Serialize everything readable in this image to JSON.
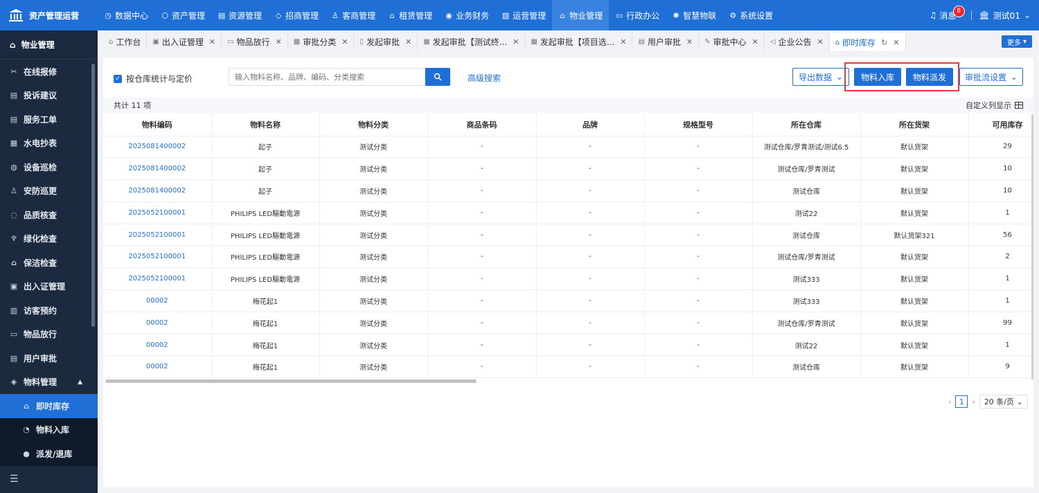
{
  "app": {
    "title": "资产管理运营"
  },
  "topnav": [
    {
      "label": "数据中心",
      "icon": "◷",
      "active": false
    },
    {
      "label": "资产管理",
      "icon": "⬡",
      "active": false
    },
    {
      "label": "资源管理",
      "icon": "▤",
      "active": false
    },
    {
      "label": "招商管理",
      "icon": "◇",
      "active": false
    },
    {
      "label": "客商管理",
      "icon": "♙",
      "active": false
    },
    {
      "label": "租赁管理",
      "icon": "⌂",
      "active": false
    },
    {
      "label": "业务财务",
      "icon": "◉",
      "active": false
    },
    {
      "label": "运营管理",
      "icon": "▨",
      "active": false
    },
    {
      "label": "物业管理",
      "icon": "⌂",
      "active": true
    },
    {
      "label": "行政办公",
      "icon": "▭",
      "active": false
    },
    {
      "label": "智慧物联",
      "icon": "✺",
      "active": false
    },
    {
      "label": "系统设置",
      "icon": "⚙",
      "active": false
    }
  ],
  "header_right": {
    "messages_label": "消息",
    "messages_count": "8",
    "user_label": "测试01"
  },
  "sidebar": {
    "title": "物业管理",
    "items": [
      {
        "label": "在线报修",
        "icon": "✂"
      },
      {
        "label": "投诉建议",
        "icon": "▤"
      },
      {
        "label": "服务工单",
        "icon": "▤"
      },
      {
        "label": "水电抄表",
        "icon": "▦"
      },
      {
        "label": "设备巡检",
        "icon": "◍"
      },
      {
        "label": "安防巡更",
        "icon": "♙"
      },
      {
        "label": "品质核查",
        "icon": "◌"
      },
      {
        "label": "绿化检查",
        "icon": "♆"
      },
      {
        "label": "保洁检查",
        "icon": "⌂"
      },
      {
        "label": "出入证管理",
        "icon": "▣"
      },
      {
        "label": "访客预约",
        "icon": "▥"
      },
      {
        "label": "物品放行",
        "icon": "▭"
      },
      {
        "label": "用户审批",
        "icon": "▤"
      }
    ],
    "group": {
      "label": "物料管理",
      "icon": "◈"
    },
    "sub_items": [
      {
        "label": "即时库存",
        "icon": "⌂",
        "active": true
      },
      {
        "label": "物料入库",
        "icon": "◔",
        "active": false
      },
      {
        "label": "派发/退库",
        "icon": "●",
        "active": false
      }
    ]
  },
  "tabs": [
    {
      "label": "工作台",
      "icon": "⌂",
      "closable": false,
      "active": false
    },
    {
      "label": "出入证管理",
      "icon": "▣",
      "closable": true,
      "active": false
    },
    {
      "label": "物品放行",
      "icon": "▭",
      "closable": true,
      "active": false
    },
    {
      "label": "审批分类",
      "icon": "▩",
      "closable": true,
      "active": false
    },
    {
      "label": "发起审批",
      "icon": "▯",
      "closable": true,
      "active": false
    },
    {
      "label": "发起审批【测试终...",
      "icon": "▦",
      "closable": true,
      "active": false
    },
    {
      "label": "发起审批【项目选...",
      "icon": "▦",
      "closable": true,
      "active": false
    },
    {
      "label": "用户审批",
      "icon": "▤",
      "closable": true,
      "active": false
    },
    {
      "label": "审批中心",
      "icon": "✎",
      "closable": true,
      "active": false
    },
    {
      "label": "企业公告",
      "icon": "◁",
      "closable": true,
      "active": false
    },
    {
      "label": "即时库存",
      "icon": "⌂",
      "closable": true,
      "active": true
    }
  ],
  "more_label": "更多",
  "toolbar": {
    "checkbox_label": "按仓库统计与定价",
    "search_placeholder": "输入物料名称、品牌、编码、分类搜索",
    "advanced_search": "高级搜索",
    "export_label": "导出数据",
    "stock_in_label": "物料入库",
    "dispatch_label": "物料派发",
    "flow_label": "审批流设置"
  },
  "summary": {
    "total_text": "共计 11 项",
    "custom_columns": "自定义列显示"
  },
  "table": {
    "columns": [
      "物料编码",
      "物料名称",
      "物料分类",
      "商品条码",
      "品牌",
      "规格型号",
      "所在仓库",
      "所在货架",
      "可用库存"
    ],
    "rows": [
      [
        "2025081400002",
        "起子",
        "测试分类",
        "-",
        "-",
        "-",
        "测试仓库/罗青测试/测试6.5",
        "默认货架",
        "29"
      ],
      [
        "2025081400002",
        "起子",
        "测试分类",
        "-",
        "-",
        "-",
        "测试仓库/罗青测试",
        "默认货架",
        "10"
      ],
      [
        "2025081400002",
        "起子",
        "测试分类",
        "-",
        "-",
        "-",
        "测试仓库",
        "默认货架",
        "10"
      ],
      [
        "2025052100001",
        "PHILIPS LED驅動電源",
        "测试分类",
        "-",
        "-",
        "-",
        "测试22",
        "默认货架",
        "1"
      ],
      [
        "2025052100001",
        "PHILIPS LED驅動電源",
        "测试分类",
        "-",
        "-",
        "-",
        "测试仓库",
        "默认货架321",
        "56"
      ],
      [
        "2025052100001",
        "PHILIPS LED驅動電源",
        "测试分类",
        "-",
        "-",
        "-",
        "测试仓库/罗青测试",
        "默认货架",
        "2"
      ],
      [
        "2025052100001",
        "PHILIPS LED驅動電源",
        "测试分类",
        "-",
        "-",
        "-",
        "测试333",
        "默认货架",
        "1"
      ],
      [
        "00002",
        "梅花起1",
        "测试分类",
        "-",
        "-",
        "-",
        "测试333",
        "默认货架",
        "1"
      ],
      [
        "00002",
        "梅花起1",
        "测试分类",
        "-",
        "-",
        "-",
        "测试仓库/罗青测试",
        "默认货架",
        "99"
      ],
      [
        "00002",
        "梅花起1",
        "测试分类",
        "-",
        "-",
        "-",
        "测试22",
        "默认货架",
        "1"
      ],
      [
        "00002",
        "梅花起1",
        "测试分类",
        "-",
        "-",
        "-",
        "测试仓库",
        "默认货架",
        "9"
      ]
    ]
  },
  "pager": {
    "current": "1",
    "page_size": "20 条/页"
  },
  "colors": {
    "primary": "#1f6fd6",
    "sidebar": "#1b2a3e",
    "highlight": "#e83a3a"
  }
}
